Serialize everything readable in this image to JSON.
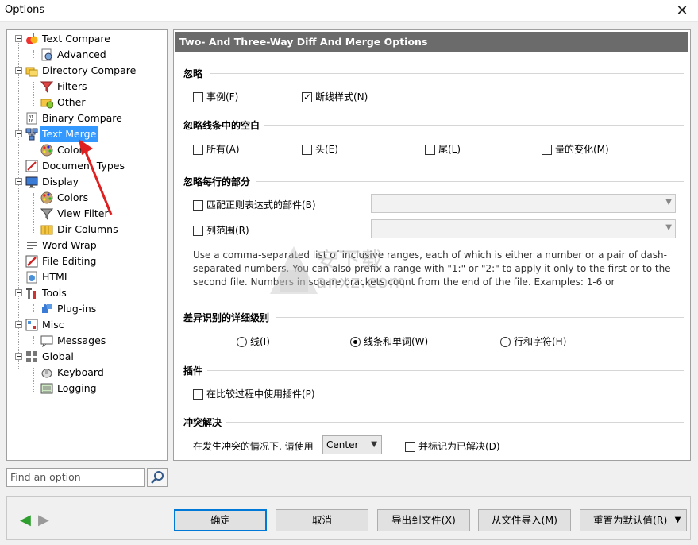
{
  "window": {
    "title": "Options",
    "close_glyph": "✕"
  },
  "tree": {
    "items": [
      {
        "label": "Text Compare",
        "icon": "text-compare-icon"
      },
      {
        "label": "Advanced",
        "icon": "advanced-icon"
      },
      {
        "label": "Directory Compare",
        "icon": "folder-compare-icon"
      },
      {
        "label": "Filters",
        "icon": "filter-icon"
      },
      {
        "label": "Other",
        "icon": "folder-other-icon"
      },
      {
        "label": "Binary Compare",
        "icon": "binary-icon"
      },
      {
        "label": "Text Merge",
        "icon": "text-merge-icon",
        "selected": true
      },
      {
        "label": "Colors",
        "icon": "palette-icon"
      },
      {
        "label": "Document Types",
        "icon": "document-types-icon"
      },
      {
        "label": "Display",
        "icon": "monitor-icon"
      },
      {
        "label": "Colors",
        "icon": "palette-icon"
      },
      {
        "label": "View Filter",
        "icon": "filter-icon"
      },
      {
        "label": "Dir Columns",
        "icon": "dir-columns-icon"
      },
      {
        "label": "Word Wrap",
        "icon": "word-wrap-icon"
      },
      {
        "label": "File Editing",
        "icon": "pencil-icon"
      },
      {
        "label": "HTML",
        "icon": "html-icon"
      },
      {
        "label": "Tools",
        "icon": "tools-icon"
      },
      {
        "label": "Plug-ins",
        "icon": "plugin-icon"
      },
      {
        "label": "Misc",
        "icon": "misc-icon"
      },
      {
        "label": "Messages",
        "icon": "message-icon"
      },
      {
        "label": "Global",
        "icon": "global-icon"
      },
      {
        "label": "Keyboard",
        "icon": "keyboard-icon"
      },
      {
        "label": "Logging",
        "icon": "logging-icon"
      }
    ]
  },
  "search": {
    "placeholder": "Find an option"
  },
  "panel": {
    "header": "Two- And Three-Way Diff And Merge Options",
    "ignore": {
      "title": "忽略",
      "case": {
        "label": "事例(F)",
        "checked": false
      },
      "line_endings": {
        "label": "断线样式(N)",
        "checked": true
      }
    },
    "whitespace": {
      "title": "忽略线条中的空白",
      "all": "所有(A)",
      "leading": "头(E)",
      "trailing": "尾(L)",
      "amount": "量的变化(M)"
    },
    "parts": {
      "title": "忽略每行的部分",
      "regex": "匹配正则表达式的部件(B)",
      "columns": "列范围(R)",
      "help": "Use a comma-separated list of inclusive ranges, each of which is either a number or a pair of dash-separated numbers. You can also prefix a range with \"1:\" or \"2:\" to apply it only to the first or to the second file. Numbers in square brackets count from the end of the file. Examples: 1-6 or"
    },
    "detail": {
      "title": "差异识别的详细级别",
      "lines": "线(I)",
      "lines_words": "线条和单词(W)",
      "lines_chars": "行和字符(H)"
    },
    "plugins": {
      "title": "插件",
      "use": "在比较过程中使用插件(P)"
    },
    "conflict": {
      "title": "冲突解决",
      "prompt": "在发生冲突的情况下, 请使用",
      "choice": "Center",
      "mark_resolved": "并标记为已解决(D)"
    }
  },
  "buttons": {
    "ok": "确定",
    "cancel": "取消",
    "export": "导出到文件(X)",
    "import": "从文件导入(M)",
    "reset": "重置为默认值(R)",
    "dropdown_glyph": "▼"
  },
  "watermark": {
    "text1": "安下载",
    "text2": "anxz.com"
  },
  "colors": {
    "selection": "#3399ff",
    "header": "#6b6b6b",
    "nav_arrow": "#2e9e2e"
  }
}
